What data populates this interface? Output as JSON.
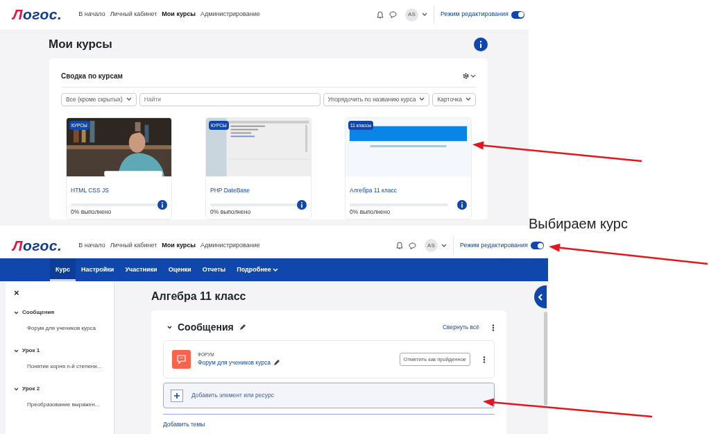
{
  "screen_1": {
    "navbar": {
      "logo_first": "Л",
      "logo_rest": "огос.",
      "links": [
        {
          "label": "В начало",
          "selected": false
        },
        {
          "label": "Личный кабинет",
          "selected": false
        },
        {
          "label": "Мои курсы",
          "selected": true
        },
        {
          "label": "Администрирование",
          "selected": false
        }
      ],
      "avatar": "AS",
      "edit_mode": {
        "label": "Режим редактирования",
        "on": true
      }
    },
    "page_title": "Мои курсы",
    "block": {
      "title": "Сводка по курсам",
      "filters": [
        {
          "kind": "select",
          "label": "Все (кроме скрытых)"
        },
        {
          "kind": "search",
          "placeholder": "Найти"
        },
        {
          "kind": "select",
          "label": "Упорядочить по названию курса"
        },
        {
          "kind": "select",
          "label": "Карточка"
        }
      ],
      "courses": [
        {
          "category": "КУРСЫ",
          "name": "HTML CSS JS",
          "level": 0,
          "progress": "0% выполнено"
        },
        {
          "category": "КУРСЫ",
          "name": "PHP DateBase",
          "level": 0,
          "progress": "0% выполнено"
        },
        {
          "category": "11 классы",
          "name": "Алгебра 11 класс",
          "level": 0,
          "progress": "0% выполнено"
        }
      ]
    }
  },
  "annotation": "Выбираем курс",
  "screen_2": {
    "navbar": {
      "logo_first": "Л",
      "logo_rest": "огос.",
      "links": [
        {
          "label": "В начало",
          "selected": false
        },
        {
          "label": "Личный кабинет",
          "selected": false
        },
        {
          "label": "Мои курсы",
          "selected": true
        },
        {
          "label": "Администрирование",
          "selected": false
        }
      ],
      "avatar": "AS",
      "edit_mode": {
        "label": "Режим редактирования",
        "on": true
      }
    },
    "course_nav": [
      {
        "label": "Курс",
        "selected": true
      },
      {
        "label": "Настройки",
        "selected": false
      },
      {
        "label": "Участники",
        "selected": false
      },
      {
        "label": "Оценки",
        "selected": false
      },
      {
        "label": "Отчеты",
        "selected": false
      },
      {
        "label": "Подробнее",
        "selected": false,
        "dropdown": true
      }
    ],
    "drawer": {
      "close": "×",
      "sections": [
        {
          "title": "Сообщения",
          "expanded": true,
          "children": [
            {
              "label": "Форум для учеников курса"
            }
          ]
        },
        {
          "title": "Урок 1",
          "expanded": true,
          "children": [
            {
              "label": "Понятие корня n-й степени..."
            }
          ]
        },
        {
          "title": "Урок 2",
          "expanded": true,
          "children": [
            {
              "label": "Преобразование выражен..."
            }
          ]
        }
      ]
    },
    "course_title": "Алгебра 11 класс",
    "section": {
      "title": "Сообщения",
      "expanded": true,
      "collapse_all": "Свернуть всё",
      "activities": [
        {
          "type": "ФОРУМ",
          "name": "Форум для учеников курса",
          "button": "Отметить как пройденное"
        }
      ],
      "add_activity": "Добавить элемент или ресурс"
    },
    "add_topics": "Добавить темы"
  }
}
